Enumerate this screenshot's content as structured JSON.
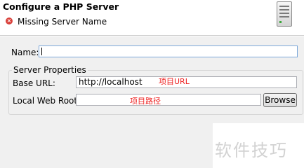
{
  "header": {
    "title": "Configure a PHP Server",
    "message": "Missing Server Name",
    "message_icon": "error-icon",
    "banner_icon": "server-icon"
  },
  "form": {
    "name_label": "Name:",
    "name_value": "",
    "group_title": "Server Properties",
    "base_url_label": "Base URL:",
    "base_url_value": "http://localhost",
    "local_web_root_label": "Local Web Root:",
    "local_web_root_value": "",
    "browse_label": "Browse"
  },
  "annotations": {
    "base_url_note": "项目URL",
    "web_root_note": "项目路径",
    "color": "#ee2222"
  },
  "watermark": "软件技巧"
}
